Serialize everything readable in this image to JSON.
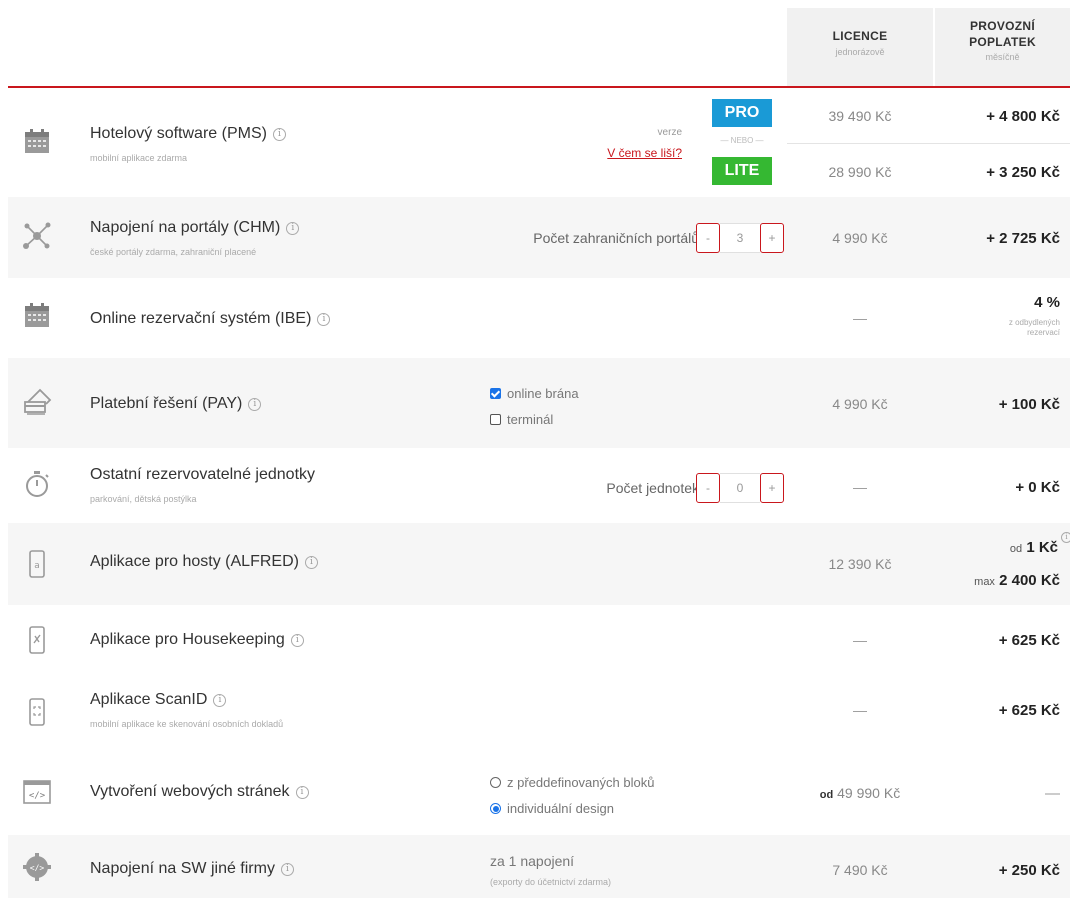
{
  "header": {
    "licence": {
      "title": "LICENCE",
      "sub": "jednorázově"
    },
    "provoz": {
      "title_line1": "PROVOZNÍ",
      "title_line2": "POPLATEK",
      "sub": "měsíčně"
    }
  },
  "rows": [
    {
      "key": "pms",
      "title": "Hotelový software (PMS)",
      "subtitle": "mobilní aplikace zdarma",
      "version_label": "verze",
      "diff_link": "V čem se liší?",
      "badge_pro": "PRO",
      "badge_or": "— NEBO —",
      "badge_lite": "LITE",
      "pro_licence": "39 490 Kč",
      "pro_fee": "+ 4 800 Kč",
      "lite_licence": "28 990 Kč",
      "lite_fee": "+ 3 250 Kč"
    },
    {
      "key": "chm",
      "title": "Napojení na portály (CHM)",
      "subtitle": "české portály zdarma, zahraniční placené",
      "stepper_label": "Počet zahraničních portálů",
      "stepper_minus": "-",
      "stepper_value": "3",
      "stepper_plus": "+",
      "licence": "4 990 Kč",
      "fee": "+ 2 725 Kč"
    },
    {
      "key": "ibe",
      "title": "Online rezervační systém (IBE)",
      "licence": "—",
      "fee": "4 %",
      "fee_note_1": "z odbydlených",
      "fee_note_2": "rezervací"
    },
    {
      "key": "pay",
      "title": "Platební řešení (PAY)",
      "option_1": "online brána",
      "option_1_checked": true,
      "option_2": "terminál",
      "option_2_checked": false,
      "licence": "4 990 Kč",
      "fee": "+ 100 Kč"
    },
    {
      "key": "units",
      "title": "Ostatní rezervovatelné jednotky",
      "subtitle": "parkování, dětská postýlka",
      "stepper_label": "Počet jednotek",
      "stepper_minus": "-",
      "stepper_value": "0",
      "stepper_plus": "+",
      "licence": "—",
      "fee": "+ 0 Kč"
    },
    {
      "key": "alfred",
      "title": "Aplikace pro hosty (ALFRED)",
      "licence": "12 390 Kč",
      "fee_from_prefix": "od",
      "fee_from": "1 Kč",
      "fee_max_prefix": "max",
      "fee_max": "2 400 Kč"
    },
    {
      "key": "housekeeping",
      "title": "Aplikace pro Housekeeping",
      "licence": "—",
      "fee": "+ 625 Kč"
    },
    {
      "key": "scanid",
      "title": "Aplikace ScanID",
      "subtitle": "mobilní aplikace ke skenování osobních dokladů",
      "licence": "—",
      "fee": "+ 625 Kč"
    },
    {
      "key": "web",
      "title": "Vytvoření webových stránek",
      "option_1": "z předdefinovaných bloků",
      "option_1_checked": false,
      "option_2": "individuální design",
      "option_2_checked": true,
      "licence_prefix": "od",
      "licence": "49 990 Kč",
      "fee": "—"
    },
    {
      "key": "sw",
      "title": "Napojení na SW jiné firmy",
      "note_main": "za 1 napojení",
      "note_sub": "(exporty do účetnictví zdarma)",
      "licence": "7 490 Kč",
      "fee": "+ 250 Kč"
    }
  ],
  "icons": {
    "pms": "calendar-icon",
    "chm": "network-icon",
    "ibe": "calendar-icon",
    "pay": "payment-card-icon",
    "units": "stopwatch-icon",
    "alfred": "smartphone-icon",
    "housekeeping": "smartphone-icon",
    "scanid": "smartphone-icon",
    "web": "code-window-icon",
    "sw": "code-gear-icon"
  },
  "colors": {
    "accent": "#c9171d",
    "pro": "#1a9ad6",
    "lite": "#35b832"
  }
}
